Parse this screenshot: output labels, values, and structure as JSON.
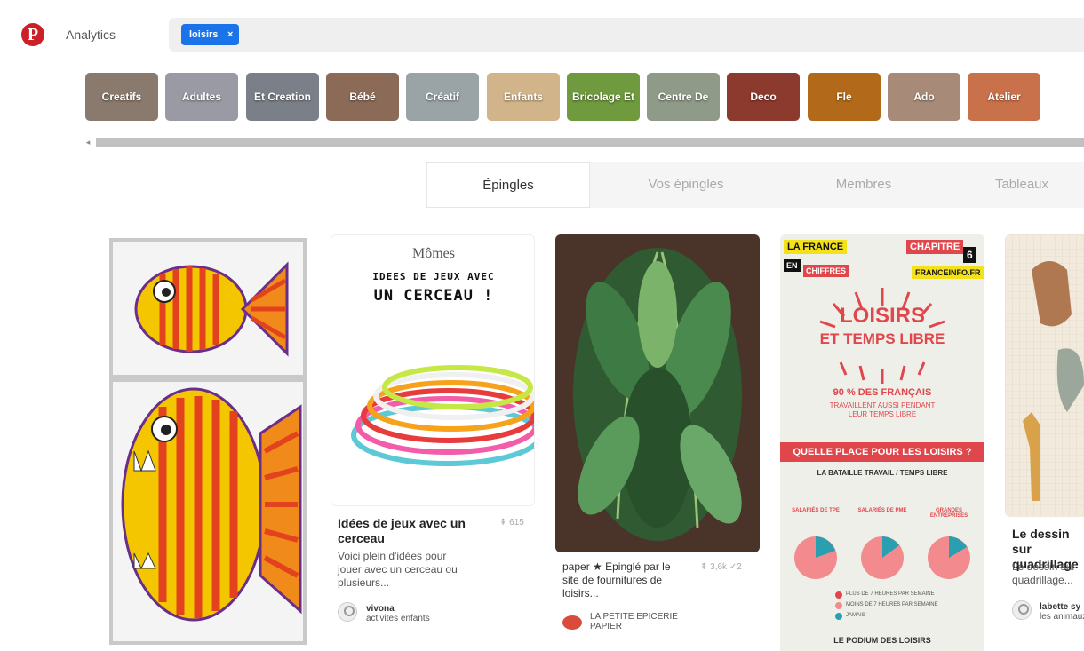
{
  "header": {
    "logo": "P",
    "analytics_label": "Analytics",
    "search": {
      "token": "loisirs",
      "token_remove": "×"
    }
  },
  "guides": [
    {
      "label": "Creatifs",
      "color": "#8a7a6e"
    },
    {
      "label": "Adultes",
      "color": "#9a9aa4"
    },
    {
      "label": "Et Creation",
      "color": "#7b7f87"
    },
    {
      "label": "Bébé",
      "color": "#8b6b58"
    },
    {
      "label": "Créatif",
      "color": "#9aa3a6"
    },
    {
      "label": "Enfants",
      "color": "#d1b48a"
    },
    {
      "label": "Bricolage Et",
      "color": "#6f9a3e"
    },
    {
      "label": "Centre De",
      "color": "#8f9a88"
    },
    {
      "label": "Deco",
      "color": "#8c3a2e"
    },
    {
      "label": "Fle",
      "color": "#b26a1a"
    },
    {
      "label": "Ado",
      "color": "#a88a78"
    },
    {
      "label": "Atelier",
      "color": "#c9714a"
    }
  ],
  "scrollbar": {
    "arrow": "◂"
  },
  "tabs": [
    {
      "label": "Épingles",
      "active": true
    },
    {
      "label": "Vos épingles",
      "active": false
    },
    {
      "label": "Membres",
      "active": false
    },
    {
      "label": "Tableaux",
      "active": false
    }
  ],
  "pins": [
    {
      "image_alt": "fish drawing"
    },
    {
      "image": {
        "brand": "Mômes",
        "line1": "IDEES DE JEUX AVEC",
        "line2": "UN CERCEAU !"
      },
      "title": "Idées de jeux avec un cerceau",
      "saves": "⇞ 615",
      "description": "Voici plein d'idées pour jouer avec un cerceau ou plusieurs...",
      "owner": "vivona",
      "board": "activites enfants"
    },
    {
      "title": "paper ★ Epinglé par le site de fournitures de loisirs...",
      "saves": "⇞ 3,6k ✓2",
      "owner": "LA PETITE EPICERIE PAPIER"
    },
    {
      "image": {
        "tag1": "LA FRANCE",
        "tag2": "EN",
        "tag3": "CHIFFRES",
        "chapter": "CHAPITRE",
        "chapter_num": "6",
        "source": "FRANCEINFO.FR",
        "headline1": "LOISIRS",
        "headline2": "ET TEMPS LIBRE",
        "stat": "90 % DES FRANÇAIS",
        "stat_sub1": "TRAVAILLENT AUSSI PENDANT",
        "stat_sub2": "LEUR TEMPS LIBRE",
        "banner": "QUELLE PLACE POUR LES LOISIRS ?",
        "battle": "LA BATAILLE TRAVAIL / TEMPS LIBRE",
        "col1": "SALARIÉS DE TPE",
        "col2": "SALARIÉS DE PME",
        "col3": "GRANDES ENTREPRISES",
        "legend1": "PLUS DE 7 HEURES PAR SEMAINE",
        "legend2": "MOINS DE 7 HEURES PAR SEMAINE",
        "legend3": "JAMAIS",
        "podium": "LE PODIUM DES LOISIRS"
      }
    },
    {
      "title": "Le dessin sur quadrillage",
      "description": "Le dessin sur quadrillage...",
      "owner": "labette sy",
      "board": "les animaux"
    }
  ]
}
